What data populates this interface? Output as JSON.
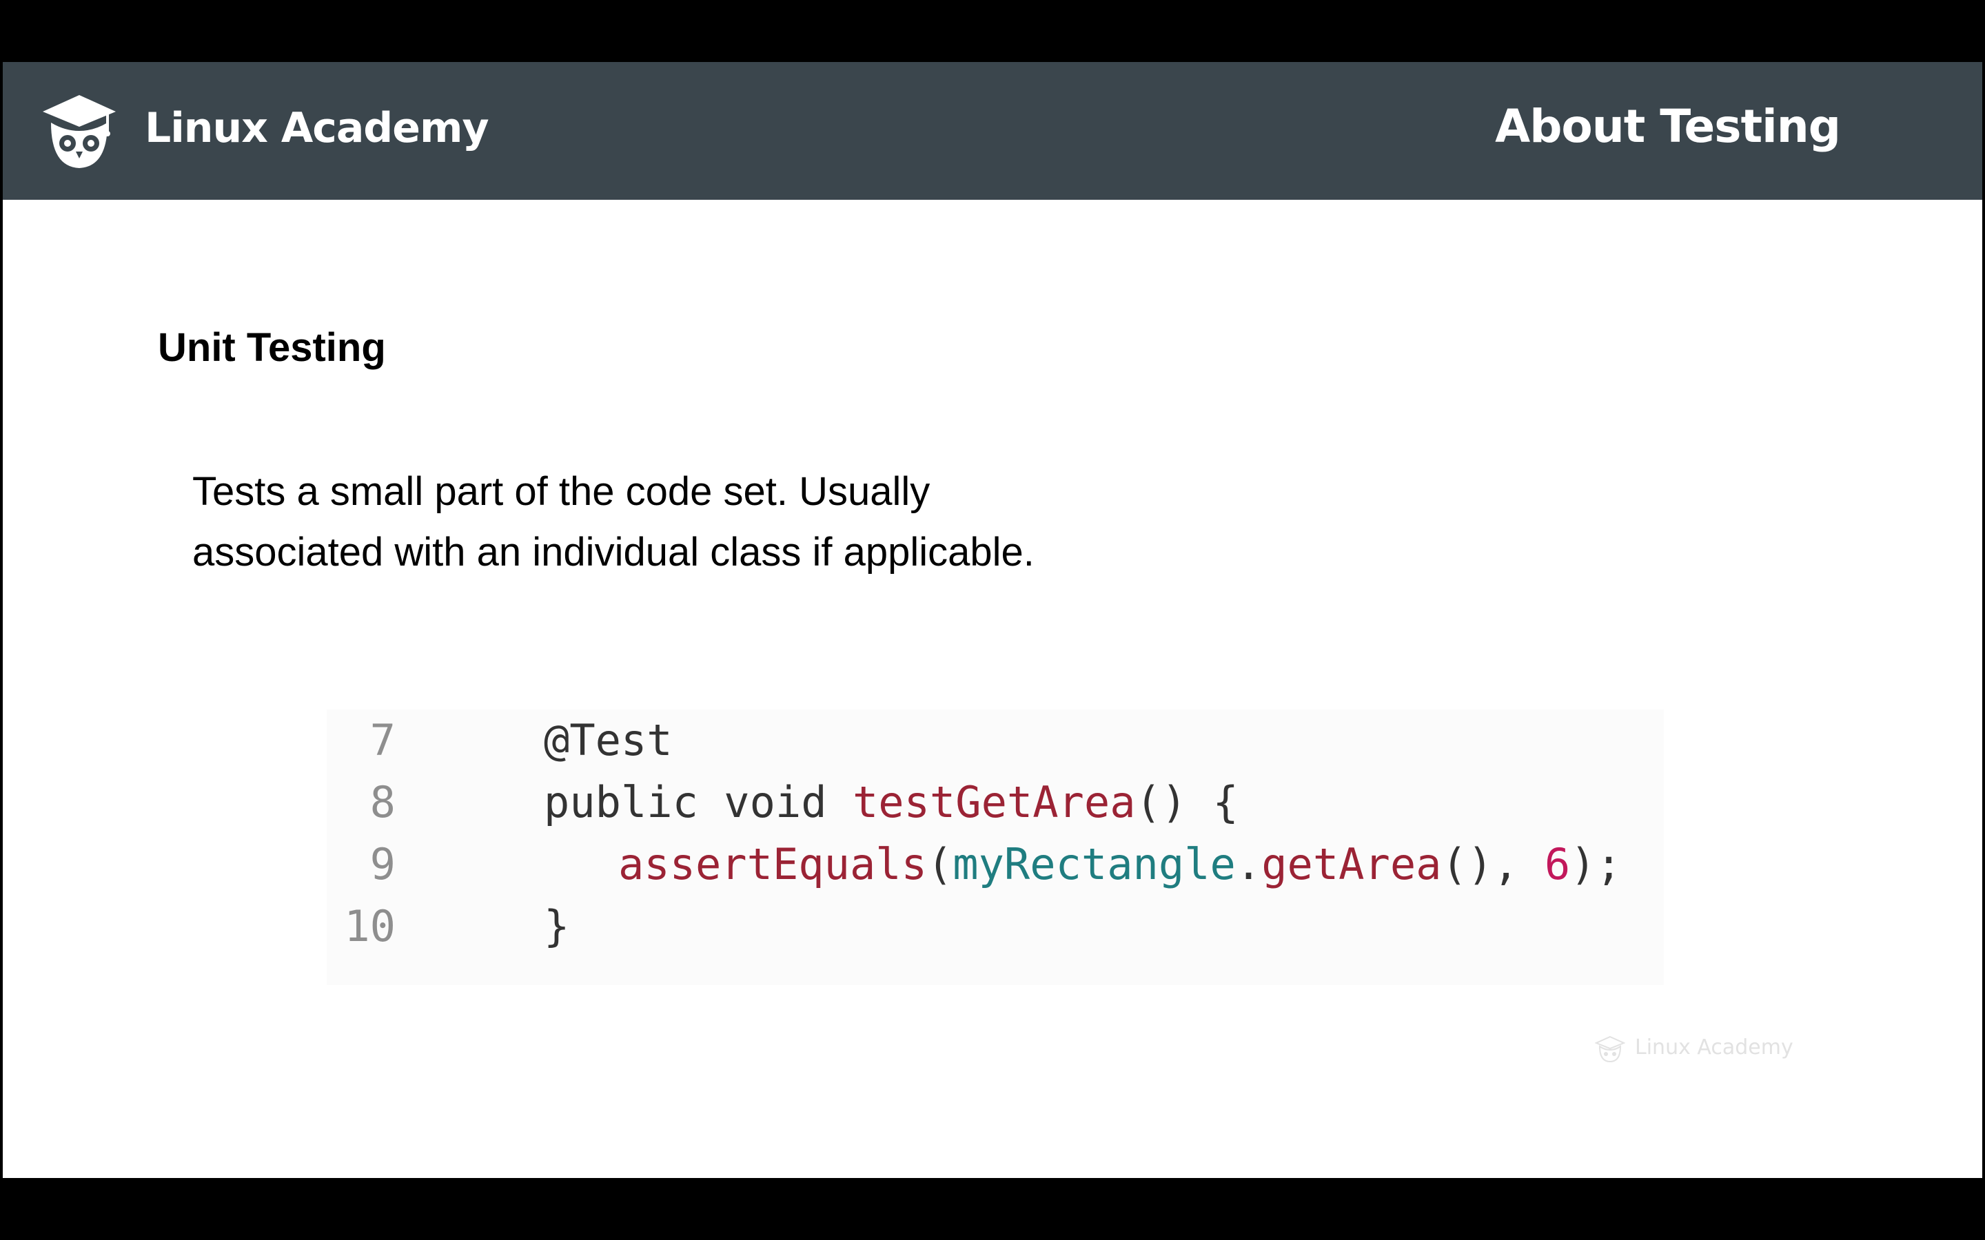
{
  "header": {
    "brand": "Linux Academy",
    "title": "About Testing"
  },
  "content": {
    "heading": "Unit Testing",
    "description_lines": [
      "Tests a small part of the code set. Usually",
      "associated with an individual class if applicable."
    ]
  },
  "code": {
    "lines": [
      {
        "number": "7",
        "tokens": [
          "@Test"
        ]
      },
      {
        "number": "8",
        "tokens": [
          "public void ",
          "testGetArea",
          "() {"
        ]
      },
      {
        "number": "9",
        "tokens": [
          "assertEquals",
          "(",
          "myRectangle",
          ".",
          "getArea",
          "(), ",
          "6",
          ");"
        ]
      },
      {
        "number": "10",
        "tokens": [
          "}"
        ]
      }
    ]
  },
  "watermark": {
    "text": "Linux Academy"
  },
  "colors": {
    "header_bg": "#3b464d",
    "method": "#9b2335",
    "variable": "#1f7d80",
    "number": "#c2185b",
    "line_number": "#8e8e8e"
  },
  "icons": {
    "logo": "owl-graduation-cap-icon",
    "watermark": "owl-graduation-cap-icon"
  }
}
